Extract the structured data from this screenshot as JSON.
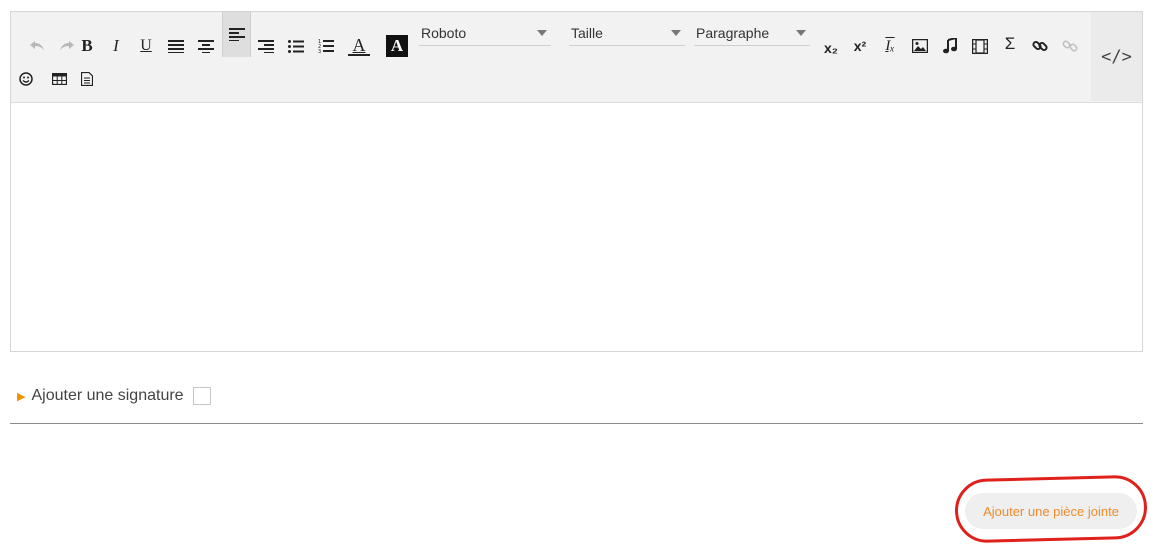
{
  "toolbar": {
    "font_family": "Roboto",
    "font_size": "Taille",
    "paragraph_format": "Paragraphe",
    "code_view_label": "</>",
    "buttons": {
      "undo_icon": "undo-icon",
      "redo_icon": "redo-icon",
      "bold_label": "B",
      "italic_label": "I",
      "underline_label": "U",
      "text_color_label": "A",
      "background_color_label": "A",
      "subscript_label": "x₂",
      "superscript_label": "x²",
      "clear_format_label": "Iₓ",
      "sigma_label": "Σ"
    }
  },
  "signature": {
    "label": "Ajouter une signature",
    "checked": false
  },
  "attachment": {
    "label": "Ajouter une pièce jointe"
  },
  "colors": {
    "accent": "#f39200",
    "attachment_text": "#ef8b2c",
    "highlight_circle": "#e0201a"
  }
}
